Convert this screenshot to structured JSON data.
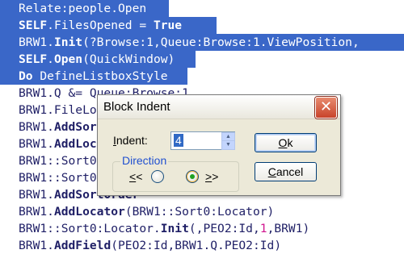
{
  "code_lines": [
    {
      "selected": true,
      "parts": [
        {
          "t": "Relate:people.Open",
          "c": ""
        }
      ]
    },
    {
      "selected": true,
      "parts": [
        {
          "t": "SELF",
          "c": "kw"
        },
        {
          "t": ".FilesOpened = ",
          "c": ""
        },
        {
          "t": "True",
          "c": "kw"
        }
      ]
    },
    {
      "selected": true,
      "parts": [
        {
          "t": "BRW1.",
          "c": ""
        },
        {
          "t": "Init",
          "c": "kw"
        },
        {
          "t": "(?Browse:1,Queue:Browse:1.ViewPosition,",
          "c": ""
        }
      ]
    },
    {
      "selected": true,
      "parts": [
        {
          "t": "SELF",
          "c": "kw"
        },
        {
          "t": ".",
          "c": ""
        },
        {
          "t": "Open",
          "c": "kw"
        },
        {
          "t": "(QuickWindow)",
          "c": ""
        }
      ]
    },
    {
      "selected": true,
      "parts": [
        {
          "t": "Do",
          "c": "kw"
        },
        {
          "t": " DefineListboxStyle",
          "c": ""
        }
      ]
    },
    {
      "selected": false,
      "parts": [
        {
          "t": "BRW1.Q &= Queue:Browse:1",
          "c": ""
        }
      ]
    },
    {
      "selected": false,
      "parts": [
        {
          "t": "BRW1.FileLoaded = 1",
          "c": ""
        }
      ]
    },
    {
      "selected": false,
      "parts": [
        {
          "t": "BRW1.",
          "c": ""
        },
        {
          "t": "AddSortOrder",
          "c": "kw"
        }
      ]
    },
    {
      "selected": false,
      "parts": [
        {
          "t": "BRW1.",
          "c": ""
        },
        {
          "t": "AddLocator",
          "c": "kw"
        }
      ]
    },
    {
      "selected": false,
      "parts": [
        {
          "t": "BRW1::Sort0:Locator.",
          "c": ""
        },
        {
          "t": "Init",
          "c": "kw"
        },
        {
          "t": "(,PEO2:Id,",
          "c": ""
        },
        {
          "t": "1",
          "c": "num"
        },
        {
          "t": ",BRW1)",
          "c": ""
        }
      ]
    },
    {
      "selected": false,
      "parts": [
        {
          "t": "BRW1::Sort0:Locator.",
          "c": ""
        }
      ]
    },
    {
      "selected": false,
      "parts": [
        {
          "t": "BRW1.",
          "c": ""
        },
        {
          "t": "AddSortOrder",
          "c": "kw"
        }
      ]
    },
    {
      "selected": false,
      "parts": [
        {
          "t": "BRW1.",
          "c": ""
        },
        {
          "t": "AddLocator",
          "c": "kw"
        },
        {
          "t": "(BRW1::Sort0:Locator)",
          "c": ""
        }
      ]
    },
    {
      "selected": false,
      "parts": [
        {
          "t": "BRW1::Sort0:Locator.",
          "c": ""
        },
        {
          "t": "Init",
          "c": "kw"
        },
        {
          "t": "(,PEO2:Id,",
          "c": ""
        },
        {
          "t": "1",
          "c": "num"
        },
        {
          "t": ",BRW1)",
          "c": ""
        }
      ]
    },
    {
      "selected": false,
      "parts": [
        {
          "t": "BRW1.",
          "c": ""
        },
        {
          "t": "AddField",
          "c": "kw"
        },
        {
          "t": "(PEO2:Id,BRW1.Q.PEO2:Id)",
          "c": ""
        }
      ]
    }
  ],
  "dialog": {
    "title": "Block Indent",
    "close_glyph": "✕",
    "indent_label_prefix": "",
    "indent_label_accel": "I",
    "indent_label_rest": "ndent:",
    "indent_value": "4",
    "direction_label": "Direction",
    "left_label_accel": "<",
    "left_label_rest": "<",
    "right_label_accel": ">",
    "right_label_rest": ">",
    "left_selected": false,
    "right_selected": true,
    "ok_label_accel": "O",
    "ok_label_rest": "k",
    "cancel_label_accel": "C",
    "cancel_label_rest": "ancel"
  }
}
